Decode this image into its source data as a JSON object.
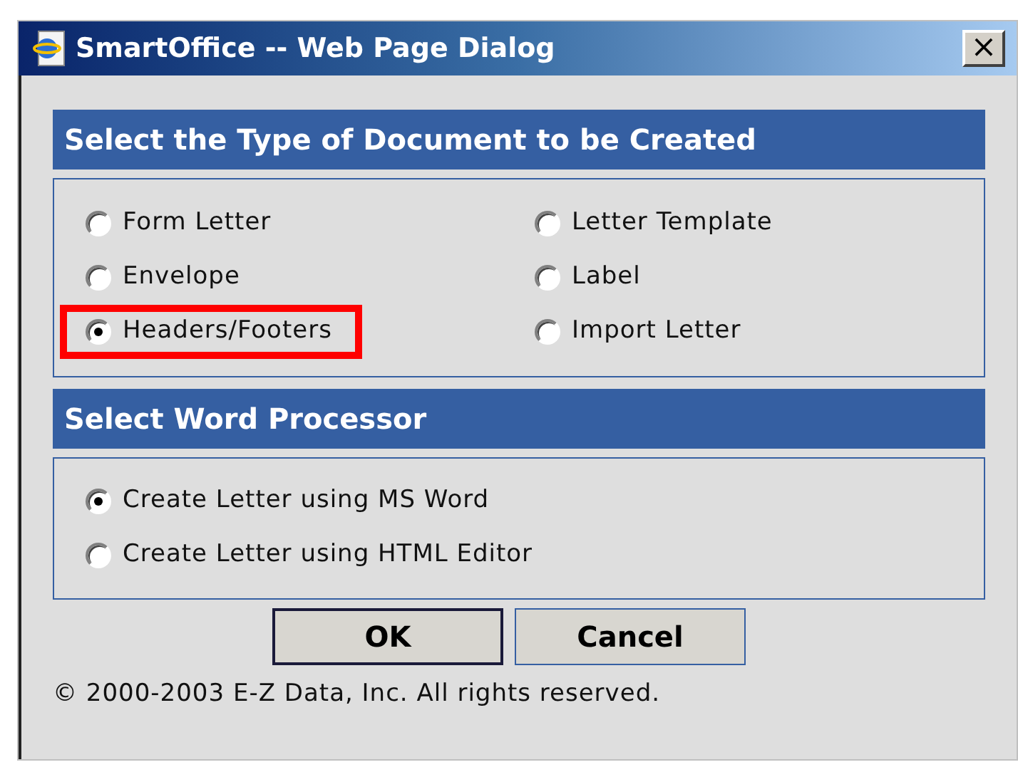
{
  "window": {
    "title": "SmartOffice -- Web Page Dialog",
    "close": "×"
  },
  "document_type": {
    "heading": "Select the Type of Document to be Created",
    "options": [
      {
        "label": "Form Letter",
        "selected": false,
        "highlighted": false
      },
      {
        "label": "Letter Template",
        "selected": false,
        "highlighted": false
      },
      {
        "label": "Envelope",
        "selected": false,
        "highlighted": false
      },
      {
        "label": "Label",
        "selected": false,
        "highlighted": false
      },
      {
        "label": "Headers/Footers",
        "selected": true,
        "highlighted": true
      },
      {
        "label": "Import Letter",
        "selected": false,
        "highlighted": false
      }
    ]
  },
  "word_processor": {
    "heading": "Select Word Processor",
    "options": [
      {
        "label": "Create Letter using MS Word",
        "selected": true
      },
      {
        "label": "Create Letter using HTML Editor",
        "selected": false
      }
    ]
  },
  "buttons": [
    {
      "label": "OK",
      "default": true
    },
    {
      "label": "Cancel",
      "default": false
    }
  ],
  "footer": "© 2000-2003 E-Z Data, Inc. All rights reserved."
}
